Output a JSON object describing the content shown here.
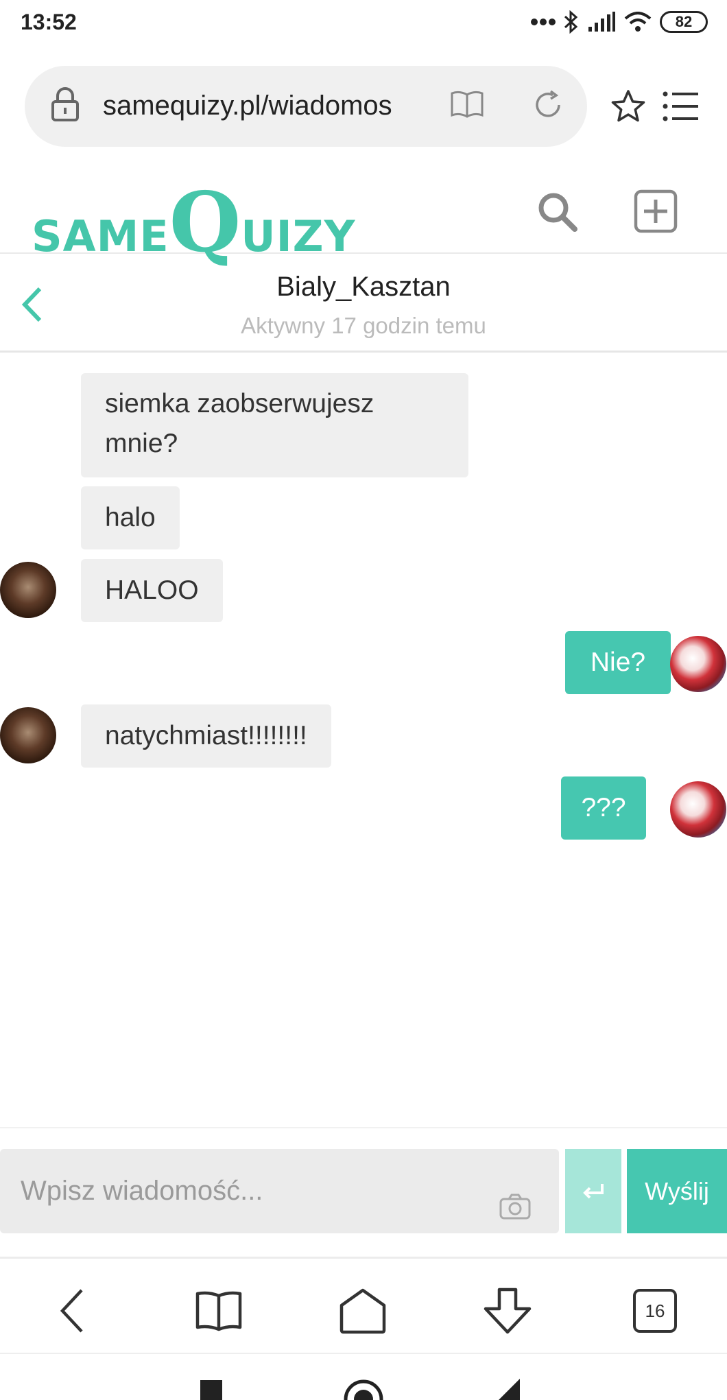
{
  "status_bar": {
    "time": "13:52",
    "battery": "82"
  },
  "browser": {
    "url": "samequizy.pl/wiadomos",
    "tabs_count": "16"
  },
  "site": {
    "logo": {
      "part1": "SAME",
      "part2": "Q",
      "part3": "UIZY"
    },
    "brand_color": "#45c6aa"
  },
  "conversation": {
    "name": "Bialy_Kasztan",
    "status": "Aktywny 17 godzin temu"
  },
  "messages": [
    {
      "direction": "incoming",
      "text": "siemka zaobserwujesz mnie?"
    },
    {
      "direction": "incoming",
      "text": "halo"
    },
    {
      "direction": "incoming",
      "text": "HALOO"
    },
    {
      "direction": "outgoing",
      "text": "Nie?"
    },
    {
      "direction": "incoming",
      "text": "natychmiast!!!!!!!!"
    },
    {
      "direction": "outgoing",
      "text": "???"
    }
  ],
  "composer": {
    "placeholder": "Wpisz wiadomość...",
    "send_label": "Wyślij"
  },
  "colors": {
    "accent": "#46c7b0",
    "accent_light": "#a6e6d9",
    "incoming_bubble": "#efefef"
  }
}
